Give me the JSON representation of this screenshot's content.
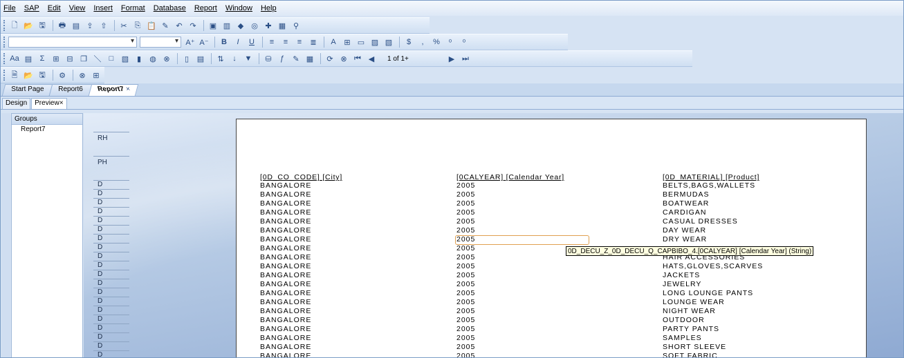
{
  "menu": [
    "File",
    "SAP",
    "Edit",
    "View",
    "Insert",
    "Format",
    "Database",
    "Report",
    "Window",
    "Help"
  ],
  "toolbar3": {
    "page_info": "1 of 1+"
  },
  "tabs": [
    {
      "label": "Start Page",
      "active": false
    },
    {
      "label": "Report6",
      "active": false
    },
    {
      "label": "Report7",
      "active": true,
      "close": "×"
    }
  ],
  "subtabs": [
    {
      "label": "Design",
      "active": false
    },
    {
      "label": "Preview",
      "active": true,
      "close": "×"
    }
  ],
  "groups": {
    "title": "Groups",
    "items": [
      "Report7"
    ]
  },
  "sections": {
    "rh": "RH",
    "ph": "PH",
    "d": "D"
  },
  "report": {
    "headers": [
      "[0D_CO_CODE] [City]",
      "[0CALYEAR] [Calendar Year]",
      "[0D_MATERIAL] [Product]"
    ],
    "rows": [
      [
        "BANGALORE",
        "2005",
        "BELTS,BAGS,WALLETS"
      ],
      [
        "BANGALORE",
        "2005",
        "BERMUDAS"
      ],
      [
        "BANGALORE",
        "2005",
        "BOATWEAR"
      ],
      [
        "BANGALORE",
        "2005",
        "CARDIGAN"
      ],
      [
        "BANGALORE",
        "2005",
        "CASUAL DRESSES"
      ],
      [
        "BANGALORE",
        "2005",
        "DAY WEAR"
      ],
      [
        "BANGALORE",
        "2005",
        "DRY WEAR"
      ],
      [
        "BANGALORE",
        "2005",
        ""
      ],
      [
        "BANGALORE",
        "2005",
        "HAIR ACCESSORIES"
      ],
      [
        "BANGALORE",
        "2005",
        "HATS,GLOVES,SCARVES"
      ],
      [
        "BANGALORE",
        "2005",
        "JACKETS"
      ],
      [
        "BANGALORE",
        "2005",
        "JEWELRY"
      ],
      [
        "BANGALORE",
        "2005",
        "LONG LOUNGE PANTS"
      ],
      [
        "BANGALORE",
        "2005",
        "LOUNGE WEAR"
      ],
      [
        "BANGALORE",
        "2005",
        "NIGHT WEAR"
      ],
      [
        "BANGALORE",
        "2005",
        "OUTDOOR"
      ],
      [
        "BANGALORE",
        "2005",
        "PARTY PANTS"
      ],
      [
        "BANGALORE",
        "2005",
        "SAMPLES"
      ],
      [
        "BANGALORE",
        "2005",
        "SHORT SLEEVE"
      ],
      [
        "BANGALORE",
        "2005",
        "SOFT FABRIC"
      ]
    ]
  },
  "tooltip": "0D_DECU_Z_0D_DECU_Q_CAPBIBO_4.[0CALYEAR] [Calendar Year] (String)",
  "colors": {
    "accent": "#2b4f86",
    "tooltip_bg": "#ffffe1",
    "selection": "#e0a050"
  }
}
